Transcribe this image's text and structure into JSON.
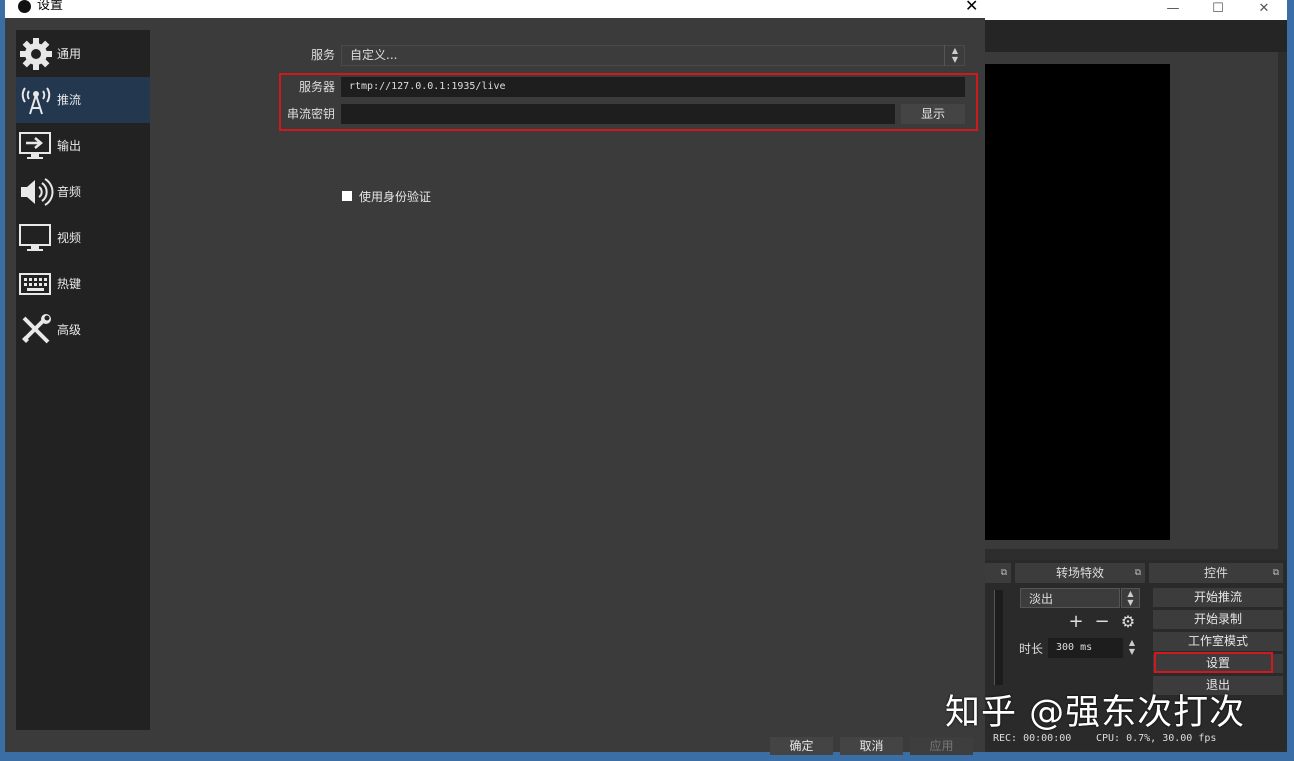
{
  "dialog": {
    "title": "设置",
    "close_label": "✕",
    "sidebar": [
      {
        "label": "通用",
        "icon": "gear-icon"
      },
      {
        "label": "推流",
        "icon": "broadcast-antenna-icon"
      },
      {
        "label": "输出",
        "icon": "output-monitor-icon"
      },
      {
        "label": "音频",
        "icon": "speaker-icon"
      },
      {
        "label": "视频",
        "icon": "monitor-icon"
      },
      {
        "label": "热键",
        "icon": "keyboard-icon"
      },
      {
        "label": "高级",
        "icon": "tools-icon"
      }
    ],
    "active_section": "推流",
    "service": {
      "label": "服务",
      "value": "自定义..."
    },
    "server": {
      "label": "服务器",
      "value": "rtmp://127.0.0.1:1935/live"
    },
    "stream_key": {
      "label": "串流密钥",
      "value": "",
      "show_button": "显示"
    },
    "auth_checkbox": {
      "label": "使用身份验证",
      "checked": false
    },
    "buttons": {
      "ok": "确定",
      "cancel": "取消",
      "apply": "应用"
    }
  },
  "main_window": {
    "controls": {
      "minimize": "—",
      "maximize": "☐",
      "close": "✕"
    },
    "transitions": {
      "header": "转场特效",
      "selected": "淡出",
      "duration_label": "时长",
      "duration_value": "300 ms"
    },
    "controls_dock": {
      "header": "控件",
      "buttons": [
        "开始推流",
        "开始录制",
        "工作室模式",
        "设置",
        "退出"
      ]
    },
    "status": {
      "rec": "REC: 00:00:00",
      "cpu": "CPU: 0.7%, 30.00 fps"
    }
  },
  "watermark": "知乎 @强东次打次",
  "colors": {
    "highlight": "#d0181e",
    "active_sidebar": "#23374f"
  }
}
